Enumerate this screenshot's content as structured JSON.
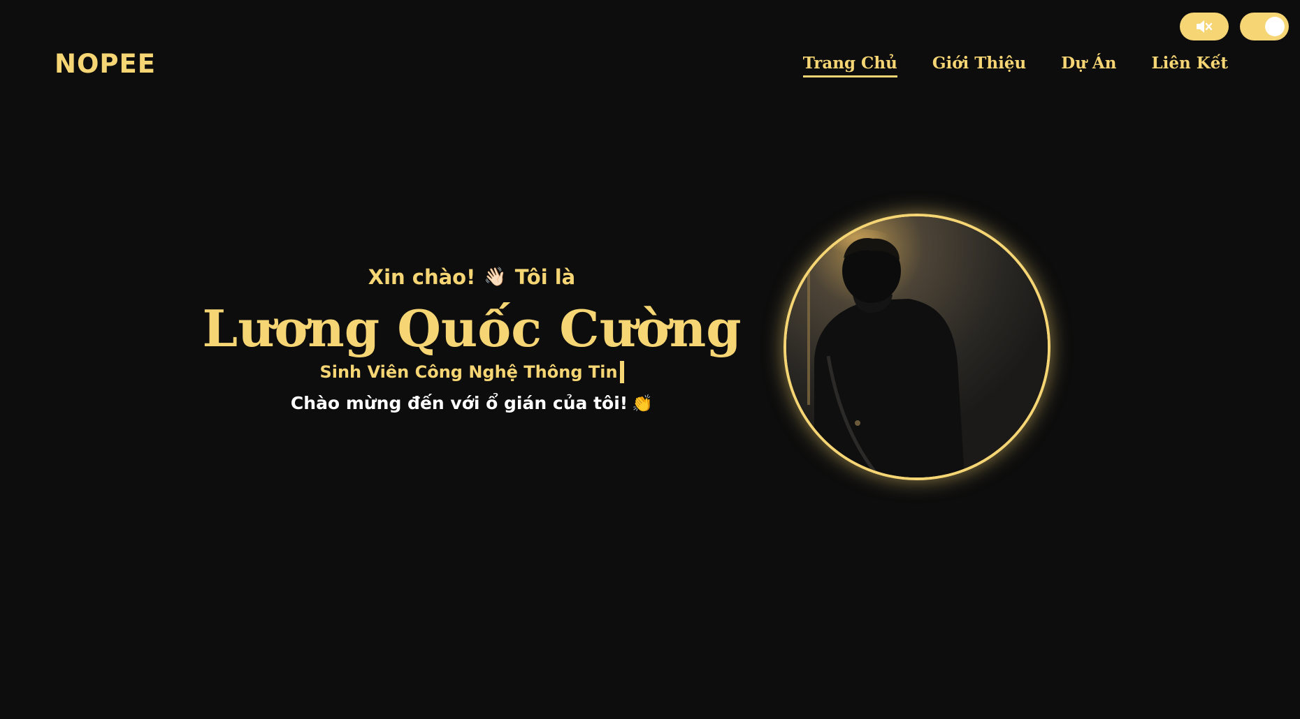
{
  "colors": {
    "accent": "#f6d574",
    "background": "#0d0d0d",
    "text_white": "#ffffff"
  },
  "controls": {
    "sound_icon": "speaker-muted-icon",
    "theme_toggle_state": "on"
  },
  "header": {
    "logo": "NOPEE",
    "nav": [
      {
        "label": "Trang Chủ",
        "active": true
      },
      {
        "label": "Giới Thiệu",
        "active": false
      },
      {
        "label": "Dự Án",
        "active": false
      },
      {
        "label": "Liên Kết",
        "active": false
      }
    ]
  },
  "hero": {
    "greeting_before": "Xin chào!",
    "greeting_icon": "👋🏻",
    "greeting_after": "Tôi là",
    "name": "Lương Quốc Cường",
    "role": "Sinh Viên Công Nghệ Thông Tin",
    "welcome": "Chào mừng đến với ổ gián của tôi!",
    "welcome_icon": "👏"
  },
  "avatar": {
    "icon": "profile-photo"
  }
}
